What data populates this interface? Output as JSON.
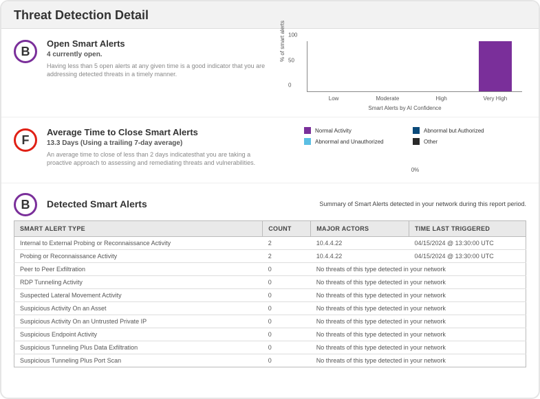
{
  "header": {
    "title": "Threat Detection Detail"
  },
  "section_open": {
    "grade": "B",
    "title": "Open Smart Alerts",
    "subtitle": "4 currently open.",
    "desc": "Having less than 5 open alerts at any given time is a good indicator that you are addressing detected threats in a timely manner."
  },
  "section_avg": {
    "grade": "F",
    "title": "Average Time to Close Smart Alerts",
    "subtitle": "13.3 Days (Using a trailing 7-day average)",
    "desc": "An average time to close of less than 2 days indicatesthat you are taking a proactive approach to assessing and remediating threats and vulnerabilities."
  },
  "chart_data": {
    "type": "bar",
    "title": "Smart Alerts by AI Confidence",
    "ylabel": "% of smart alerts",
    "categories": [
      "Low",
      "Moderate",
      "High",
      "Very High"
    ],
    "values": [
      0,
      0,
      0,
      100
    ],
    "yticks": [
      0,
      50,
      100
    ],
    "ylim": [
      0,
      100
    ]
  },
  "donut": {
    "legend": [
      {
        "name": "Normal Activity",
        "swatch": "sw-na"
      },
      {
        "name": "Abnormal but Authorized",
        "swatch": "sw-aa"
      },
      {
        "name": "Abnormal and Unauthorized",
        "swatch": "sw-au"
      },
      {
        "name": "Other",
        "swatch": "sw-ot"
      }
    ],
    "center_label": "0%"
  },
  "detected": {
    "grade": "B",
    "title": "Detected Smart Alerts",
    "summary": "Summary of Smart Alerts detected in your network during this report period.",
    "columns": {
      "c0": "SMART ALERT TYPE",
      "c1": "COUNT",
      "c2": "MAJOR ACTORS",
      "c3": "TIME LAST TRIGGERED"
    },
    "no_threats": "No threats of this type detected in your network",
    "rows": [
      {
        "type": "Internal to External Probing or Reconnaissance Activity",
        "count": "2",
        "actors": "10.4.4.22",
        "time": "04/15/2024 @ 13:30:00 UTC"
      },
      {
        "type": "Probing or Reconnaissance Activity",
        "count": "2",
        "actors": "10.4.4.22",
        "time": "04/15/2024 @ 13:30:00 UTC"
      },
      {
        "type": "Peer to Peer Exfiltration",
        "count": "0"
      },
      {
        "type": "RDP Tunneling Activity",
        "count": "0"
      },
      {
        "type": "Suspected Lateral Movement Activity",
        "count": "0"
      },
      {
        "type": "Suspicious Activity On an Asset",
        "count": "0"
      },
      {
        "type": "Suspicious Activity On an Untrusted Private IP",
        "count": "0"
      },
      {
        "type": "Suspicious Endpoint Activity",
        "count": "0"
      },
      {
        "type": "Suspicious Tunneling Plus Data Exfiltration",
        "count": "0"
      },
      {
        "type": "Suspicious Tunneling Plus Port Scan",
        "count": "0"
      }
    ]
  }
}
